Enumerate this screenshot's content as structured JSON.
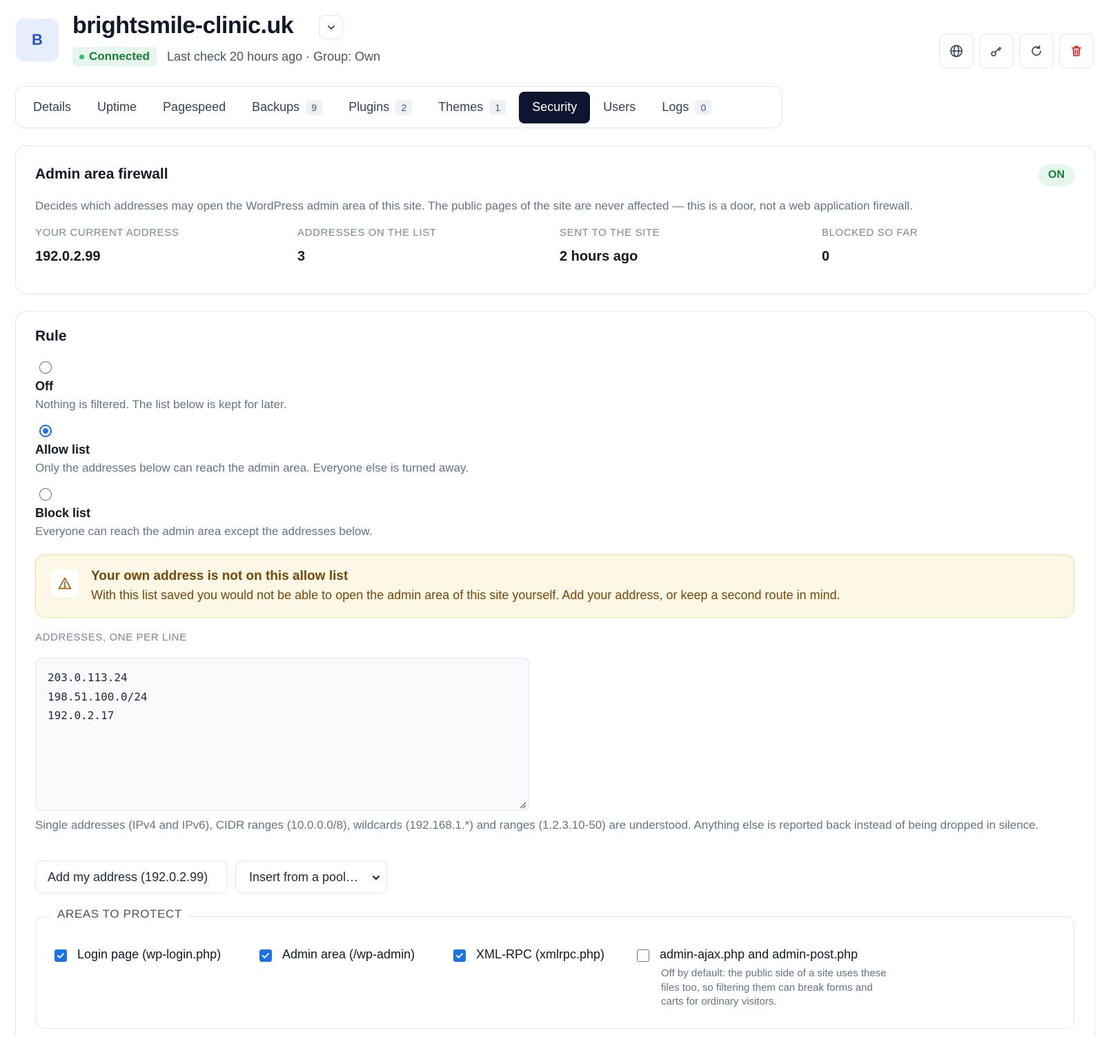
{
  "site": {
    "avatar_letter": "B",
    "title": "brightsmile-clinic.uk",
    "status": "Connected",
    "meta": "Last check 20 hours ago · Group: Own"
  },
  "header_actions": [
    {
      "name": "globe-icon"
    },
    {
      "name": "key-icon"
    },
    {
      "name": "refresh-icon"
    },
    {
      "name": "trash-icon",
      "color": "#dc2626"
    }
  ],
  "tabs": [
    {
      "label": "Details",
      "count": null
    },
    {
      "label": "Uptime",
      "count": null
    },
    {
      "label": "Pagespeed",
      "count": null
    },
    {
      "label": "Backups",
      "count": "9"
    },
    {
      "label": "Plugins",
      "count": "2"
    },
    {
      "label": "Themes",
      "count": "1"
    },
    {
      "label": "Security",
      "count": null,
      "active": true
    },
    {
      "label": "Users",
      "count": null
    },
    {
      "label": "Logs",
      "count": "0"
    }
  ],
  "firewall": {
    "title": "Admin area firewall",
    "state": "ON",
    "description": "Decides which addresses may open the WordPress admin area of this site. The public pages of the site are never affected — this is a door, not a web application firewall.",
    "stats": [
      {
        "label": "YOUR CURRENT ADDRESS",
        "value": "192.0.2.99"
      },
      {
        "label": "ADDRESSES ON THE LIST",
        "value": "3"
      },
      {
        "label": "SENT TO THE SITE",
        "value": "2 hours ago"
      },
      {
        "label": "BLOCKED SO FAR",
        "value": "0"
      }
    ]
  },
  "rule": {
    "title": "Rule",
    "selected": "Allow list",
    "options": [
      {
        "label": "Off",
        "description": "Nothing is filtered. The list below is kept for later."
      },
      {
        "label": "Allow list",
        "description": "Only the addresses below can reach the admin area. Everyone else is turned away."
      },
      {
        "label": "Block list",
        "description": "Everyone can reach the admin area except the addresses below."
      }
    ],
    "warning": {
      "title": "Your own address is not on this allow list",
      "text": "With this list saved you would not be able to open the admin area of this site yourself. Add your address, or keep a second route in mind."
    },
    "addresses_label": "ADDRESSES, ONE PER LINE",
    "addresses_value": "203.0.113.24\n198.51.100.0/24\n192.0.2.17",
    "help": "Single addresses (IPv4 and IPv6), CIDR ranges (10.0.0.0/8), wildcards (192.168.1.*) and ranges (1.2.3.10-50) are understood. Anything else is reported back instead of being dropped in silence.",
    "add_my_address_label": "Add my address (192.0.2.99)",
    "pool_select_label": "Insert from a pool…",
    "areas_legend": "AREAS TO PROTECT",
    "areas": [
      {
        "label": "Login page (wp-login.php)",
        "checked": true
      },
      {
        "label": "Admin area (/wp-admin)",
        "checked": true
      },
      {
        "label": "XML-RPC (xmlrpc.php)",
        "checked": true
      },
      {
        "label": "admin-ajax.php and admin-post.php",
        "checked": false,
        "note": "Off by default: the public side of a site uses these files too, so filtering them can break forms and carts for ordinary visitors."
      }
    ]
  },
  "colors": {
    "accent": "#1a73e8",
    "tab_active_bg": "#0d1530",
    "success": "#16803a",
    "warning_text": "#7a4608",
    "danger": "#dc2626"
  }
}
